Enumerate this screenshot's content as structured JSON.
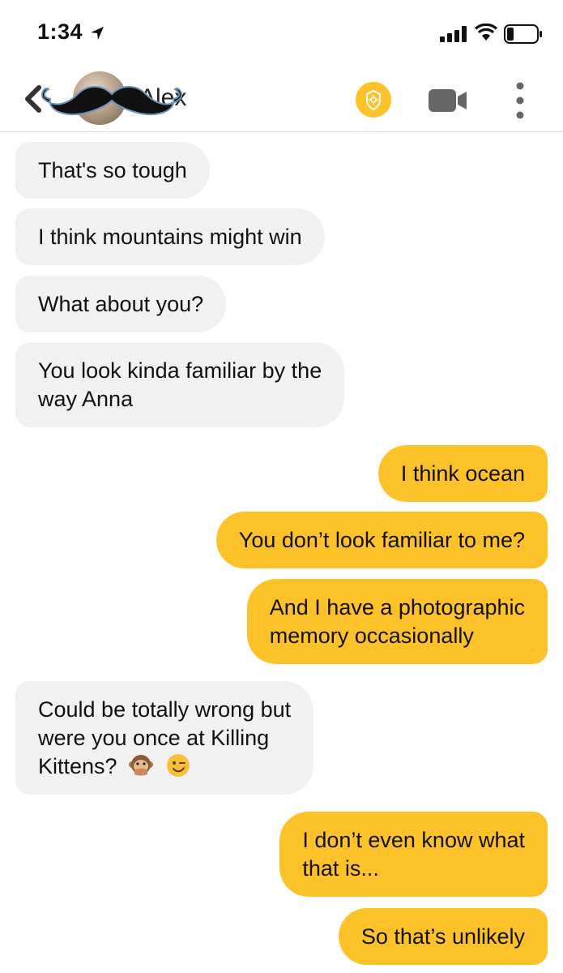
{
  "status_bar": {
    "time": "1:34",
    "icons": [
      "location-arrow-icon",
      "cellular-signal-icon",
      "wifi-icon",
      "battery-icon"
    ]
  },
  "header": {
    "match_name": "Alex",
    "icons": [
      "back-chevron-icon",
      "avatar",
      "mustache-overlay",
      "verification-badge-icon",
      "video-call-icon",
      "more-options-icon"
    ],
    "accent_color": "#fdc12a"
  },
  "messages": [
    {
      "sender": "them",
      "lines": [
        "That's so tough"
      ]
    },
    {
      "sender": "them",
      "lines": [
        "I think mountains might win"
      ]
    },
    {
      "sender": "them",
      "lines": [
        "What about you?"
      ]
    },
    {
      "sender": "them",
      "lines": [
        "You look kinda familiar by the",
        "way Anna"
      ]
    },
    {
      "sender": "me",
      "lines": [
        "I think ocean"
      ]
    },
    {
      "sender": "me",
      "lines": [
        "You don’t look familiar to me?"
      ]
    },
    {
      "sender": "me",
      "lines": [
        "And I have a photographic",
        "memory occasionally"
      ]
    },
    {
      "sender": "them",
      "lines": [
        "Could be totally wrong but",
        "were you once at Killing",
        "Kittens?"
      ],
      "emojis": [
        "speak-no-evil-monkey-emoji",
        "winking-face-emoji"
      ]
    },
    {
      "sender": "me",
      "lines": [
        "I don’t even know what",
        "that is..."
      ]
    },
    {
      "sender": "me",
      "lines": [
        "So that’s unlikely"
      ]
    }
  ],
  "colors": {
    "incoming_bubble": "#f1f1f1",
    "outgoing_bubble": "#fdc12a"
  }
}
